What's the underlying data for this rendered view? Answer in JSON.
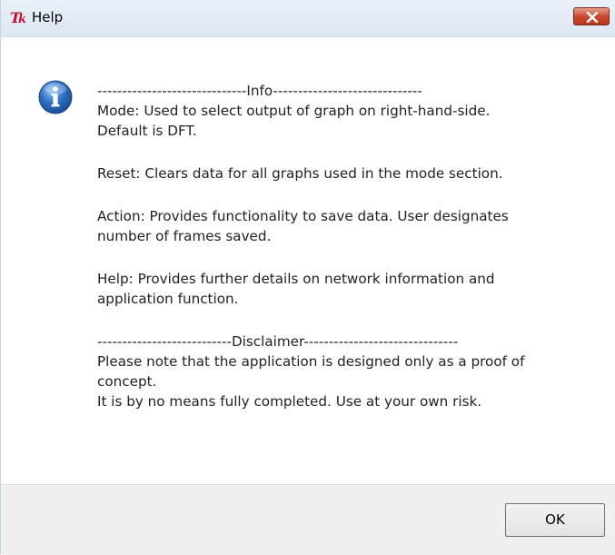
{
  "window": {
    "title": "Help",
    "app_icon": "tk-feather-icon",
    "close_icon": "close-icon"
  },
  "message": {
    "icon": "info-icon",
    "lines": [
      "------------------------------Info------------------------------",
      "Mode: Used to select output of graph on right-hand-side.",
      "Default is DFT.",
      "",
      "Reset: Clears data for all graphs used in the mode section.",
      "",
      "Action: Provides functionality to save data. User designates",
      "number of frames saved.",
      "",
      "Help: Provides further details on network information and",
      "application function.",
      "",
      "---------------------------Disclaimer-------------------------------",
      "Please note that the application is designed only as a proof of",
      "concept.",
      "It is by no means fully completed. Use at your own risk."
    ]
  },
  "buttons": {
    "ok_label": "OK"
  },
  "colors": {
    "info_icon_blue": "#2f6fc0",
    "close_button_red": "#c94a30",
    "footer_gray": "#f0f0f0"
  }
}
